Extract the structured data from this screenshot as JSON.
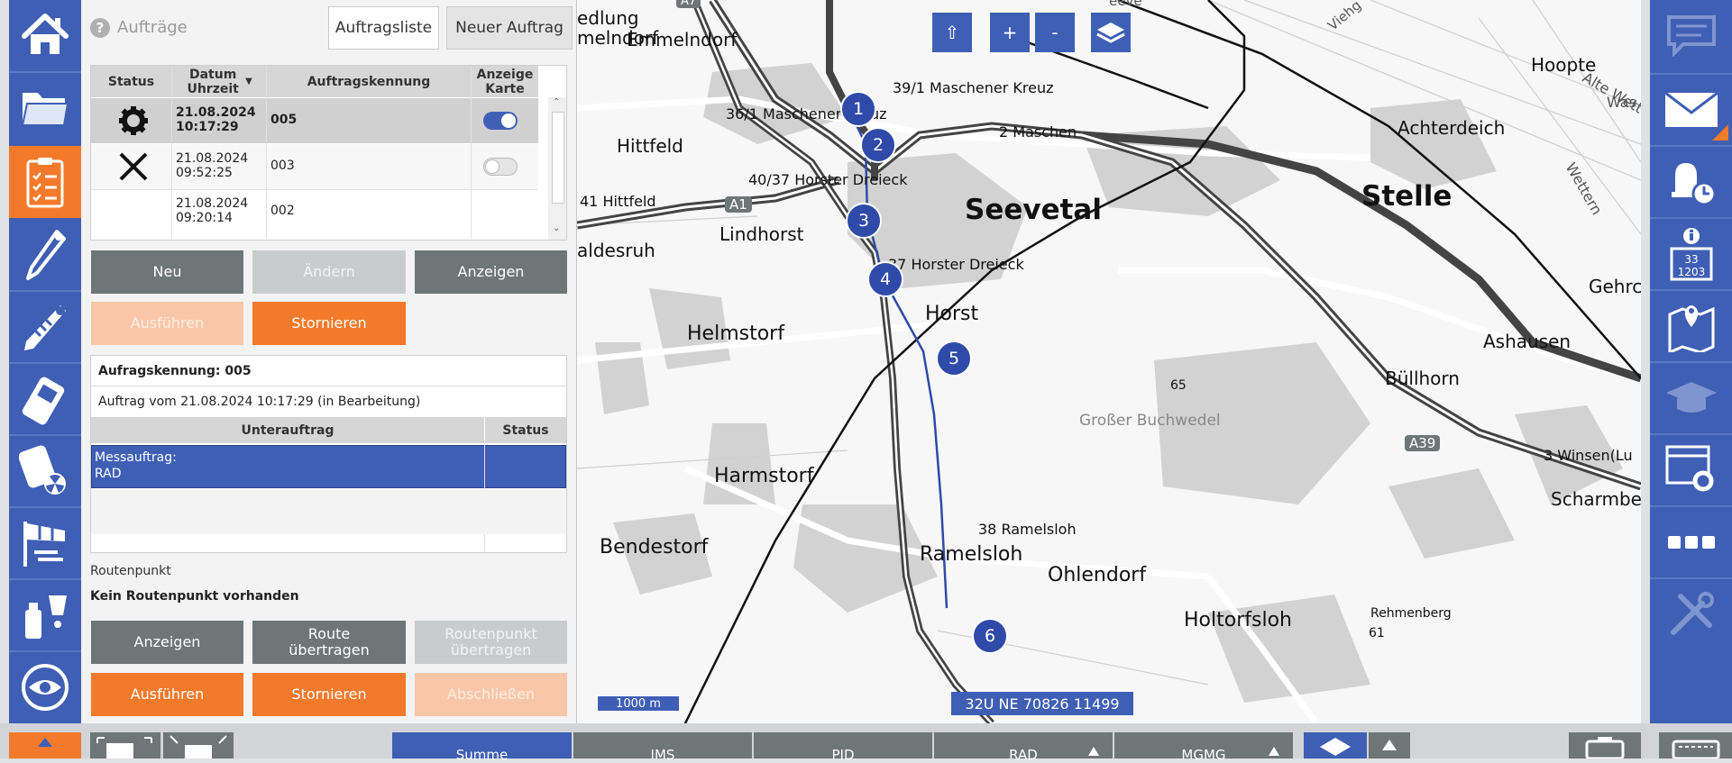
{
  "panel": {
    "title": "Aufträge",
    "tab_list": "Auftragsliste",
    "tab_new": "Neuer Auftrag",
    "table": {
      "headers": {
        "status": "Status",
        "date": "Datum Uhrzeit",
        "id": "Auftragskennung",
        "show": "Anzeige Karte"
      },
      "rows": [
        {
          "status_icon": "gear-icon",
          "date": "21.08.2024",
          "time": "10:17:29",
          "id": "005",
          "toggle": true
        },
        {
          "status_icon": "cross-icon",
          "date": "21.08.2024",
          "time": "09:52:25",
          "id": "003",
          "toggle": false
        },
        {
          "status_icon": "",
          "date": "21.08.2024",
          "time": "09:20:14",
          "id": "002",
          "toggle": null
        }
      ]
    },
    "actions": {
      "new": "Neu",
      "edit": "Ändern",
      "show": "Anzeigen",
      "execute": "Ausführen",
      "cancel": "Stornieren"
    },
    "detail": {
      "heading": "Aufragskennung: 005",
      "subtitle": "Auftrag vom 21.08.2024 10:17:29 (in Bearbeitung)",
      "sub_headers": {
        "order": "Unterauftrag",
        "status": "Status"
      },
      "sub_rows": [
        {
          "line1": "Messauftrag:",
          "line2": "RAD",
          "status": ""
        }
      ]
    },
    "route": {
      "label": "Routenpunkt",
      "empty": "Kein Routenpunkt vorhanden",
      "show": "Anzeigen",
      "transfer_route": "Route übertragen",
      "transfer_point": "Routenpunkt übertragen",
      "execute": "Ausführen",
      "cancel": "Stornieren",
      "finish": "Abschließen"
    }
  },
  "map": {
    "controls": {
      "up": "⇧",
      "zoom_in": "+",
      "zoom_out": "-"
    },
    "scale": "1000 m",
    "coords": "32U NE 70826 11499",
    "route_points": [
      "1",
      "2",
      "3",
      "4",
      "5",
      "6"
    ],
    "labels": {
      "emmelndorf": "Emmelndorf",
      "hittfeld": "Hittfeld",
      "seevetal": "Seevetal",
      "stelle": "Stelle",
      "lindhorst": "Lindhorst",
      "helmstorf": "Helmstorf",
      "horst": "Horst",
      "harmstorf": "Harmstorf",
      "bendestorf": "Bendestorf",
      "ramelsloh": "Ramelsloh",
      "ohlendorf": "Ohlendorf",
      "holtorfsloh": "Holtorfsloh",
      "buellhorn": "Büllhorn",
      "ashausen": "Ashausen",
      "achterdeich": "Achterdeich",
      "hoopte": "Hoopte",
      "grosser_buchwedel": "Großer Buchwedel",
      "rehmenberg": "Rehmenberg",
      "elev_61": "61",
      "elev_65": "65",
      "a1": "A1",
      "a39": "A39",
      "a7": "A7",
      "maschener_kreuz": "39/1 Maschener Kreuz",
      "maschener_kreuz2": "36/1 Maschener Kreuz",
      "horster_dreieck1": "40/37 Horster Dreieck",
      "horster_dreieck2": "37 Horster Dreieck",
      "hittfeld_junction": "41 Hittfeld",
      "maschen": "2 Maschen",
      "ramelsloh_junction": "38 Ramelsloh",
      "winsen": "3 Winsen(Lu",
      "scharmbeck": "Scharmbe",
      "gehrden": "Gehrc",
      "aldesruh": "aldesruh",
      "medlung": "edlung",
      "meindorf": "melndorf",
      "alte_wettern": "Alte Wettern",
      "wettern": "Wettern",
      "viehg": "Viehg",
      "seeve": "eeve",
      "was": "Was"
    }
  },
  "bottom": {
    "tabs": [
      "Summe",
      "IMS",
      "PID",
      "RAD",
      "MGMG"
    ]
  },
  "colors": {
    "rail": "#3f5fb5",
    "accent": "#f47a2b",
    "button_gray": "#6e7678"
  }
}
